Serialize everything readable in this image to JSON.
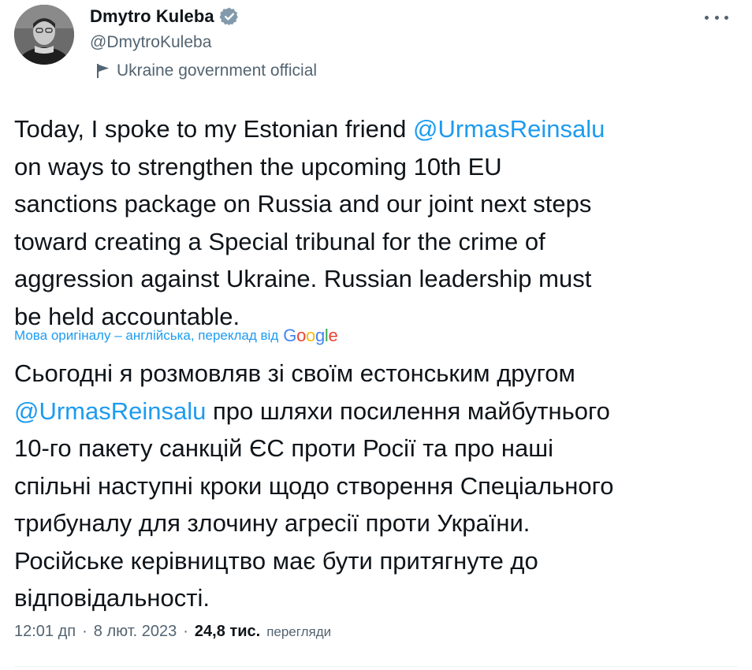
{
  "author": {
    "name": "Dmytro Kuleba",
    "handle": "@DmytroKuleba",
    "label": "Ukraine government official"
  },
  "tweet": {
    "original_lines": [
      {
        "before": "Today, I spoke to my Estonian friend ",
        "mention": "@UrmasReinsalu",
        "after": ""
      },
      {
        "before": "on ways to strengthen the upcoming 10th EU",
        "mention": "",
        "after": ""
      },
      {
        "before": "sanctions package on Russia and our joint next steps",
        "mention": "",
        "after": ""
      },
      {
        "before": "toward creating a Special tribunal for the crime of",
        "mention": "",
        "after": ""
      },
      {
        "before": "aggression against Ukraine. Russian leadership must",
        "mention": "",
        "after": ""
      },
      {
        "before": "be held accountable.",
        "mention": "",
        "after": ""
      }
    ],
    "translation_note": "Мова оригіналу – англійська, переклад від",
    "translation_provider": {
      "g1": "G",
      "o1": "o",
      "o2": "o",
      "g2": "g",
      "l": "l",
      "e": "e"
    },
    "translated_lines": [
      {
        "before": "Сьогодні я розмовляв зі своїм естонським другом",
        "mention": "",
        "after": ""
      },
      {
        "before": "",
        "mention": "@UrmasReinsalu",
        "after": " про шляхи посилення майбутнього"
      },
      {
        "before": "10-го пакету санкцій ЄС проти Росії та про наші",
        "mention": "",
        "after": ""
      },
      {
        "before": "спільні наступні кроки щодо створення Спеціального",
        "mention": "",
        "after": ""
      },
      {
        "before": "трибуналу для злочину агресії проти України.",
        "mention": "",
        "after": ""
      },
      {
        "before": "Російське керівництво має бути притягнуте до",
        "mention": "",
        "after": ""
      },
      {
        "before": "відповідальності.",
        "mention": "",
        "after": ""
      }
    ]
  },
  "meta": {
    "time": "12:01 дп",
    "separator": "·",
    "date": "8 лют. 2023",
    "views_count": "24,8 тис.",
    "views_label": "перегляди"
  },
  "icons": {
    "verified": "verified-badge-icon",
    "label": "flag-icon",
    "more": "more-icon"
  },
  "colors": {
    "accent": "#1d9bf0",
    "text": "#0f1419",
    "secondary": "#536471"
  }
}
